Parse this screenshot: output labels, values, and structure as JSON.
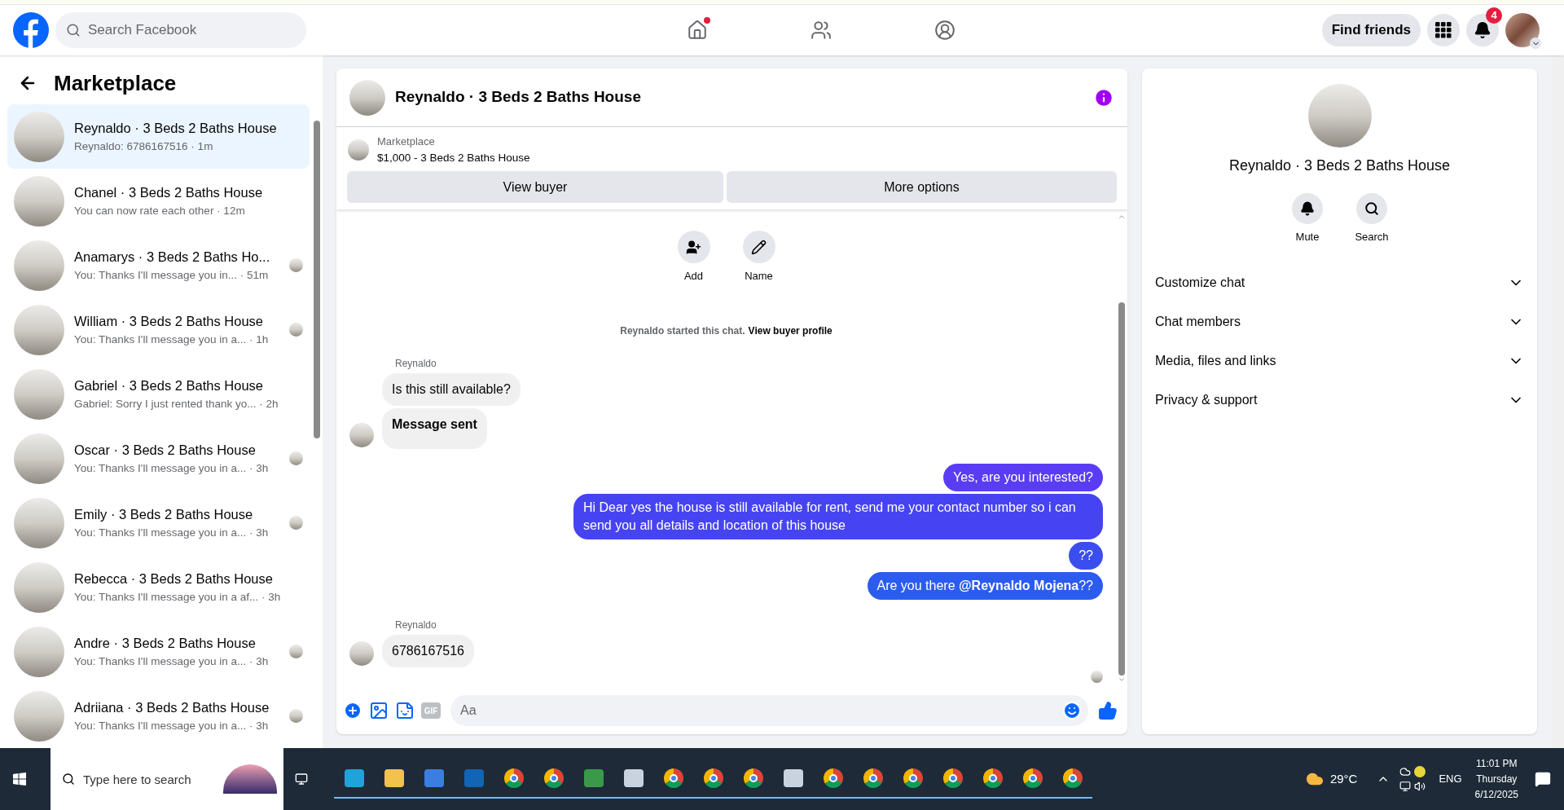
{
  "top_bar": {
    "search": {
      "placeholder": "Search Facebook"
    },
    "nav": [
      {
        "kind": "home",
        "has_dot": true
      },
      {
        "kind": "friends",
        "has_dot": false
      },
      {
        "kind": "profile",
        "has_dot": false
      }
    ],
    "find_friends": "Find friends",
    "notification_count": "4"
  },
  "sidebar": {
    "title": "Marketplace",
    "conversations": [
      {
        "title": "Reynaldo · 3 Beds 2 Baths House",
        "preview": "Reynaldo: 6786167516 · 1m",
        "selected": true,
        "seen_avatar": false
      },
      {
        "title": "Chanel · 3 Beds 2 Baths House",
        "preview": "You can now rate each other · 12m",
        "selected": false,
        "seen_avatar": false
      },
      {
        "title": "Anamarys · 3 Beds 2 Baths Ho...",
        "preview": "You: Thanks I'll message you in... · 51m",
        "selected": false,
        "seen_avatar": true
      },
      {
        "title": "William · 3 Beds 2 Baths House",
        "preview": "You: Thanks I'll message you in a... · 1h",
        "selected": false,
        "seen_avatar": true
      },
      {
        "title": "Gabriel · 3 Beds 2 Baths House",
        "preview": "Gabriel: Sorry I just rented thank yo... · 2h",
        "selected": false,
        "seen_avatar": false
      },
      {
        "title": "Oscar · 3 Beds 2 Baths House",
        "preview": "You: Thanks I'll message you in a... · 3h",
        "selected": false,
        "seen_avatar": true
      },
      {
        "title": "Emily · 3 Beds 2 Baths House",
        "preview": "You: Thanks I'll message you in a... · 3h",
        "selected": false,
        "seen_avatar": true
      },
      {
        "title": "Rebecca · 3 Beds 2 Baths House",
        "preview": "You: Thanks I'll message you in a af... · 3h",
        "selected": false,
        "seen_avatar": false
      },
      {
        "title": "Andre · 3 Beds 2 Baths House",
        "preview": "You: Thanks I'll message you in a... · 3h",
        "selected": false,
        "seen_avatar": true
      },
      {
        "title": "Adriiana · 3 Beds 2 Baths House",
        "preview": "You: Thanks I'll message you in a... · 3h",
        "selected": false,
        "seen_avatar": true
      }
    ]
  },
  "chat": {
    "title": "Reynaldo · 3 Beds 2 Baths House",
    "listing_label": "Marketplace",
    "listing": "$1,000 - 3 Beds 2 Baths House",
    "buttons": [
      "View buyer",
      "More options"
    ],
    "actions": [
      {
        "kind": "add",
        "label": "Add"
      },
      {
        "kind": "name",
        "label": "Name"
      }
    ],
    "started": "Reynaldo started this chat.",
    "profile_link": "View buyer profile",
    "groups": [
      {
        "kind": "incoming",
        "sender": "Reynaldo",
        "bubbles": [
          {
            "text": "Is this still available?",
            "bold": false
          },
          {
            "text": "Message sent",
            "bold": true
          }
        ]
      },
      {
        "kind": "outgoing",
        "bubbles": [
          {
            "text": "Yes, are you interested?",
            "color": "#5a3cf4"
          },
          {
            "text": "Hi Dear yes the house is still available for rent, send me your contact number so i can send you all details and location of this house",
            "color": "#4643f2"
          },
          {
            "text": "??",
            "color": "#3a4ef0"
          },
          {
            "text": "Are you there **@Reynaldo Mojena**??",
            "color": "#2c5cef"
          }
        ]
      },
      {
        "kind": "incoming",
        "sender": "Reynaldo",
        "bubbles": [
          {
            "text": "6786167516",
            "bold": false
          }
        ]
      }
    ],
    "composer": {
      "placeholder": "Aa",
      "gif": "GIF"
    }
  },
  "details": {
    "title": "Reynaldo · 3 Beds 2 Baths House",
    "actions": [
      {
        "kind": "mute",
        "label": "Mute"
      },
      {
        "kind": "search",
        "label": "Search"
      }
    ],
    "sections": [
      "Customize chat",
      "Chat members",
      "Media, files and links",
      "Privacy & support"
    ]
  },
  "taskbar": {
    "search": {
      "placeholder": "Type here to search"
    },
    "temperature": "29°C",
    "language": "ENG",
    "time": "11:01 PM",
    "day": "Thursday",
    "date": "6/12/2025"
  }
}
